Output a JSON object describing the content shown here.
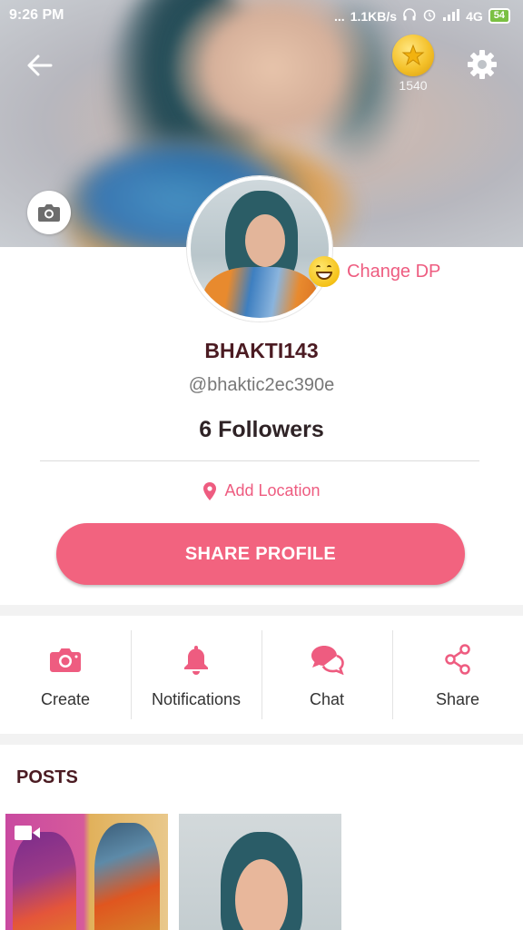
{
  "status_bar": {
    "time": "9:26 PM",
    "dots": "...",
    "net_speed": "1.1KB/s",
    "network": "4G",
    "battery": "54"
  },
  "header": {
    "coin_count": "1540",
    "change_dp_label": "Change DP"
  },
  "profile": {
    "username": "BHAKTI143",
    "handle": "@bhaktic2ec390e",
    "followers": "6 Followers",
    "add_location_label": "Add Location",
    "share_button_label": "SHARE PROFILE"
  },
  "actions": [
    {
      "label": "Create",
      "icon": "camera-icon"
    },
    {
      "label": "Notifications",
      "icon": "bell-icon"
    },
    {
      "label": "Chat",
      "icon": "chat-bubbles-icon"
    },
    {
      "label": "Share",
      "icon": "share-icon"
    }
  ],
  "posts": {
    "title": "POSTS"
  },
  "colors": {
    "accent": "#f2637f",
    "accent_text": "#ee5c80",
    "title_text": "#4b1b22"
  }
}
